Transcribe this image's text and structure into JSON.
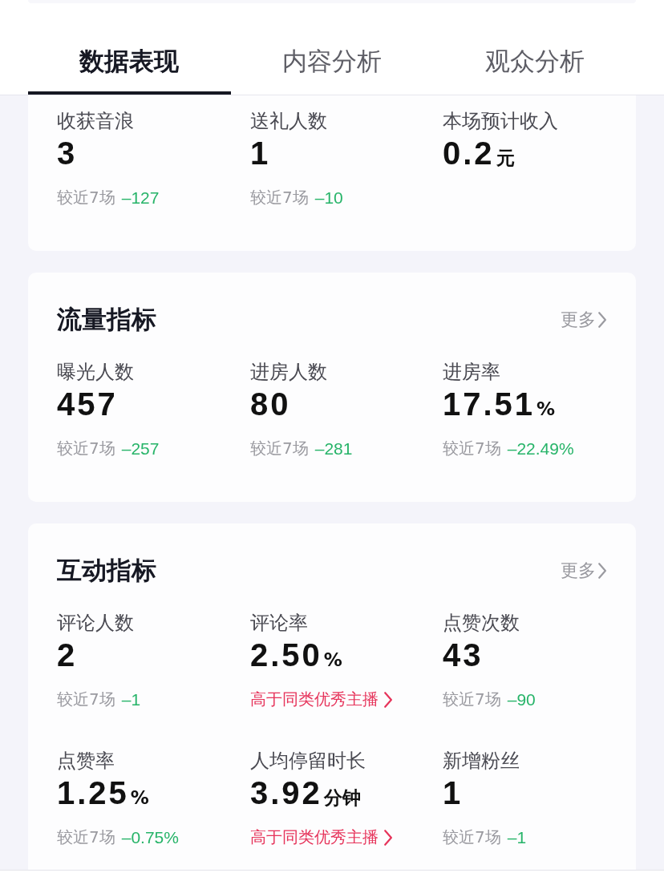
{
  "tabs": [
    {
      "label": "数据表现",
      "selected": true
    },
    {
      "label": "内容分析",
      "selected": false
    },
    {
      "label": "观众分析",
      "selected": false
    }
  ],
  "sections": [
    {
      "metrics": [
        {
          "label": "收获音浪",
          "value": "3",
          "footer": {
            "kind": "compare",
            "label": "较近7场",
            "delta": "–127"
          }
        },
        {
          "label": "送礼人数",
          "value": "1",
          "footer": {
            "kind": "compare",
            "label": "较近7场",
            "delta": "–10"
          }
        },
        {
          "label": "本场预计收入",
          "value": "0.2",
          "unit": "元"
        }
      ]
    },
    {
      "title": "流量指标",
      "more": "更多",
      "metrics": [
        {
          "label": "曝光人数",
          "value": "457",
          "footer": {
            "kind": "compare",
            "label": "较近7场",
            "delta": "–257"
          }
        },
        {
          "label": "进房人数",
          "value": "80",
          "footer": {
            "kind": "compare",
            "label": "较近7场",
            "delta": "–281"
          }
        },
        {
          "label": "进房率",
          "value": "17.51",
          "unit": "%",
          "footer": {
            "kind": "compare",
            "label": "较近7场",
            "delta": "–22.49%"
          }
        }
      ]
    },
    {
      "title": "互动指标",
      "more": "更多",
      "metrics": [
        {
          "label": "评论人数",
          "value": "2",
          "footer": {
            "kind": "compare",
            "label": "较近7场",
            "delta": "–1"
          }
        },
        {
          "label": "评论率",
          "value": "2.50",
          "unit": "%",
          "footer": {
            "kind": "badge",
            "text": "高于同类优秀主播"
          }
        },
        {
          "label": "点赞次数",
          "value": "43",
          "footer": {
            "kind": "compare",
            "label": "较近7场",
            "delta": "–90"
          }
        },
        {
          "label": "点赞率",
          "value": "1.25",
          "unit": "%",
          "footer": {
            "kind": "compare",
            "label": "较近7场",
            "delta": "–0.75%"
          }
        },
        {
          "label": "人均停留时长",
          "value": "3.92",
          "unit": "分钟",
          "footer": {
            "kind": "badge",
            "text": "高于同类优秀主播"
          }
        },
        {
          "label": "新增粉丝",
          "value": "1",
          "footer": {
            "kind": "compare",
            "label": "较近7场",
            "delta": "–1"
          }
        }
      ]
    }
  ]
}
